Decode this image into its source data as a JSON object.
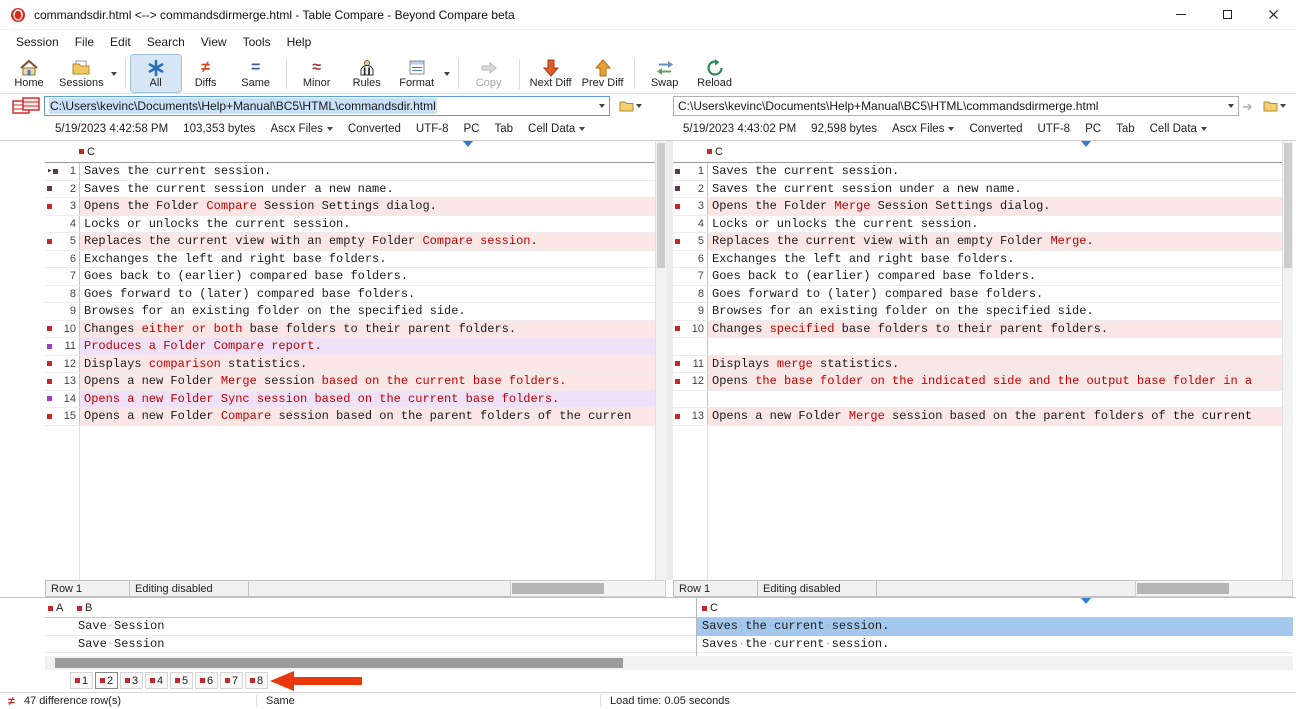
{
  "titlebar": {
    "title": "commandsdir.html <--> commandsdirmerge.html - Table Compare - Beyond Compare beta"
  },
  "menu": {
    "items": [
      "Session",
      "File",
      "Edit",
      "Search",
      "View",
      "Tools",
      "Help"
    ]
  },
  "toolbar": {
    "items": [
      {
        "label": "Home"
      },
      {
        "label": "Sessions",
        "dropdown": true
      },
      {
        "label": "All",
        "selected": true
      },
      {
        "label": "Diffs",
        "icon_glyph": "≠"
      },
      {
        "label": "Same",
        "icon_glyph": "="
      },
      {
        "label": "Minor",
        "icon_glyph": "≈"
      },
      {
        "label": "Rules"
      },
      {
        "label": "Format",
        "dropdown": true
      },
      {
        "label": "Copy",
        "disabled": true
      },
      {
        "label": "Next Diff"
      },
      {
        "label": "Prev Diff"
      },
      {
        "label": "Swap"
      },
      {
        "label": "Reload"
      }
    ]
  },
  "left_pane": {
    "path": "C:\\Users\\kevinc\\Documents\\Help+Manual\\BC5\\HTML\\commandsdir.html",
    "info": {
      "timestamp": "5/19/2023 4:42:58 PM",
      "size": "103,353 bytes",
      "file_format": "Ascx Files",
      "conversion": "Converted",
      "encoding": "UTF-8",
      "line_endings": "PC",
      "delimiter": "Tab",
      "view_mode": "Cell Data"
    },
    "column_header": "C",
    "footer": {
      "row": "Row 1",
      "editing": "Editing disabled"
    },
    "rows": [
      {
        "n": "1",
        "bg": "w",
        "cur": true,
        "m": "d",
        "segs": [
          {
            "t": "Saves the current session."
          }
        ]
      },
      {
        "n": "2",
        "bg": "w",
        "m": "d",
        "segs": [
          {
            "t": "Saves the current session under a new name."
          }
        ]
      },
      {
        "n": "3",
        "bg": "p",
        "m": "r",
        "segs": [
          {
            "t": "Opens the Folder "
          },
          {
            "t": "Compare",
            "r": 1
          },
          {
            "t": " Session Settings dialog."
          }
        ]
      },
      {
        "n": "4",
        "bg": "w",
        "segs": [
          {
            "t": "Locks or unlocks the current session."
          }
        ]
      },
      {
        "n": "5",
        "bg": "p",
        "m": "r",
        "segs": [
          {
            "t": "Replaces the current view with an empty Folder "
          },
          {
            "t": "Compare session",
            "r": 1
          },
          {
            "t": "."
          }
        ]
      },
      {
        "n": "6",
        "bg": "w",
        "segs": [
          {
            "t": "Exchanges the left and right base folders."
          }
        ]
      },
      {
        "n": "7",
        "bg": "w",
        "segs": [
          {
            "t": "Goes back to (earlier) compared base folders."
          }
        ]
      },
      {
        "n": "8",
        "bg": "w",
        "segs": [
          {
            "t": "Goes forward to (later) compared base folders."
          }
        ]
      },
      {
        "n": "9",
        "bg": "w",
        "segs": [
          {
            "t": "Browses for an existing folder on the specified side."
          }
        ]
      },
      {
        "n": "10",
        "bg": "p",
        "m": "r",
        "segs": [
          {
            "t": "Changes "
          },
          {
            "t": "either or both",
            "r": 1
          },
          {
            "t": " base folders to their parent folders."
          }
        ]
      },
      {
        "n": "11",
        "bg": "v",
        "m": "v",
        "segs": [
          {
            "t": "Produces a Folder Compare report.",
            "r": 1
          }
        ]
      },
      {
        "n": "12",
        "bg": "p",
        "m": "r",
        "segs": [
          {
            "t": "Displays "
          },
          {
            "t": "comparison",
            "r": 1
          },
          {
            "t": " statistics."
          }
        ]
      },
      {
        "n": "13",
        "bg": "p",
        "m": "r",
        "segs": [
          {
            "t": "Opens a new Folder "
          },
          {
            "t": "Merge",
            "r": 1
          },
          {
            "t": " session "
          },
          {
            "t": "based on the current base folders.",
            "r": 1
          }
        ]
      },
      {
        "n": "14",
        "bg": "v",
        "m": "v",
        "segs": [
          {
            "t": "Opens a new Folder Sync session based on the current base folders.",
            "r": 1
          }
        ]
      },
      {
        "n": "15",
        "bg": "p",
        "m": "r",
        "segs": [
          {
            "t": "Opens a new Folder "
          },
          {
            "t": "Compare",
            "r": 1
          },
          {
            "t": " session based on the parent folders of the curren"
          }
        ]
      }
    ]
  },
  "right_pane": {
    "path": "C:\\Users\\kevinc\\Documents\\Help+Manual\\BC5\\HTML\\commandsdirmerge.html",
    "info": {
      "timestamp": "5/19/2023 4:43:02 PM",
      "size": "92,598 bytes",
      "file_format": "Ascx Files",
      "conversion": "Converted",
      "encoding": "UTF-8",
      "line_endings": "PC",
      "delimiter": "Tab",
      "view_mode": "Cell Data"
    },
    "column_header": "C",
    "footer": {
      "row": "Row 1",
      "editing": "Editing disabled"
    },
    "rows": [
      {
        "n": "1",
        "bg": "w",
        "m": "d",
        "segs": [
          {
            "t": "Saves the current session."
          }
        ]
      },
      {
        "n": "2",
        "bg": "w",
        "m": "d",
        "segs": [
          {
            "t": "Saves the current session under a new name."
          }
        ]
      },
      {
        "n": "3",
        "bg": "p",
        "m": "r",
        "segs": [
          {
            "t": "Opens the Folder "
          },
          {
            "t": "Merge",
            "r": 1
          },
          {
            "t": " Session Settings dialog."
          }
        ]
      },
      {
        "n": "4",
        "bg": "w",
        "segs": [
          {
            "t": "Locks or unlocks the current session."
          }
        ]
      },
      {
        "n": "5",
        "bg": "p",
        "m": "r",
        "segs": [
          {
            "t": "Replaces the current view with an empty Folder "
          },
          {
            "t": "Merge",
            "r": 1
          },
          {
            "t": "."
          }
        ]
      },
      {
        "n": "6",
        "bg": "w",
        "segs": [
          {
            "t": "Exchanges the left and right base folders."
          }
        ]
      },
      {
        "n": "7",
        "bg": "w",
        "segs": [
          {
            "t": "Goes back to (earlier) compared base folders."
          }
        ]
      },
      {
        "n": "8",
        "bg": "w",
        "segs": [
          {
            "t": "Goes forward to (later) compared base folders."
          }
        ]
      },
      {
        "n": "9",
        "bg": "w",
        "segs": [
          {
            "t": "Browses for an existing folder on the specified side."
          }
        ]
      },
      {
        "n": "10",
        "bg": "p",
        "m": "r",
        "segs": [
          {
            "t": "Changes "
          },
          {
            "t": "specified",
            "r": 1
          },
          {
            "t": " base folders to their parent folders."
          }
        ]
      },
      {
        "bg": "gap"
      },
      {
        "n": "11",
        "bg": "p",
        "m": "r",
        "segs": [
          {
            "t": "Displays "
          },
          {
            "t": "merge",
            "r": 1
          },
          {
            "t": " statistics."
          }
        ]
      },
      {
        "n": "12",
        "bg": "p",
        "m": "r",
        "segs": [
          {
            "t": "Opens "
          },
          {
            "t": "the base folder on the indicated side and the output base folder in a",
            "r": 1
          }
        ]
      },
      {
        "bg": "gap"
      },
      {
        "n": "13",
        "bg": "p",
        "m": "r",
        "segs": [
          {
            "t": "Opens a new Folder "
          },
          {
            "t": "Merge",
            "r": 1
          },
          {
            "t": " session based on the parent folders of the current"
          }
        ]
      }
    ]
  },
  "detail": {
    "left": {
      "col_a": "A",
      "col_b": "B",
      "rows": [
        {
          "text": "Save·Session"
        },
        {
          "text": "Save·Session"
        }
      ]
    },
    "right": {
      "col_c": "C",
      "rows": [
        {
          "text": "Saves·the·current·session.",
          "selected": true
        },
        {
          "text": "Saves·the·current·session."
        }
      ]
    }
  },
  "bottom_tabs": {
    "tabs": [
      "1",
      "2",
      "3",
      "4",
      "5",
      "6",
      "7",
      "8"
    ],
    "active_index": 1
  },
  "status_bar": {
    "diff_icon": "≠",
    "diff_count": "47 difference row(s)",
    "row_status": "Same",
    "load_time": "Load time: 0.05 seconds"
  },
  "colors": {
    "diff_text": "#c00000",
    "diff_row_bg": "#fbe6e6",
    "orphan_row_bg": "#efe1f7",
    "selection_bg": "#a4c7ed",
    "annotation_arrow": "#e8380c"
  }
}
